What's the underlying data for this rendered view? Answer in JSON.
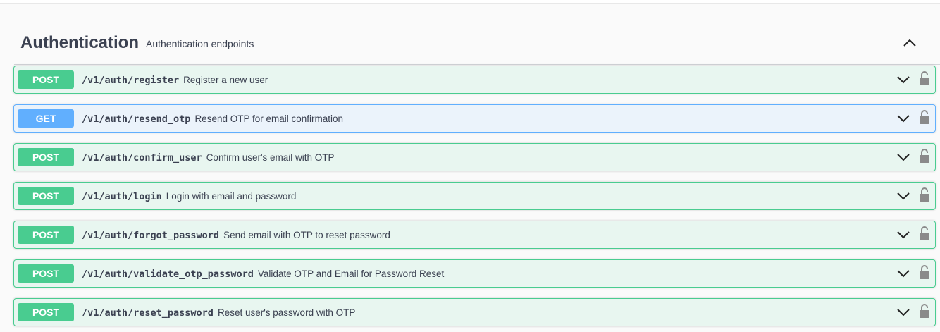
{
  "section": {
    "title": "Authentication",
    "description": "Authentication endpoints"
  },
  "operations": [
    {
      "method": "POST",
      "path": "/v1/auth/register",
      "summary": "Register a new user"
    },
    {
      "method": "GET",
      "path": "/v1/auth/resend_otp",
      "summary": "Resend OTP for email confirmation"
    },
    {
      "method": "POST",
      "path": "/v1/auth/confirm_user",
      "summary": "Confirm user's email with OTP"
    },
    {
      "method": "POST",
      "path": "/v1/auth/login",
      "summary": "Login with email and password"
    },
    {
      "method": "POST",
      "path": "/v1/auth/forgot_password",
      "summary": "Send email with OTP to reset password"
    },
    {
      "method": "POST",
      "path": "/v1/auth/validate_otp_password",
      "summary": "Validate OTP and Email for Password Reset"
    },
    {
      "method": "POST",
      "path": "/v1/auth/reset_password",
      "summary": "Reset user's password with OTP"
    }
  ],
  "icons": {
    "collapse": "chevron-up-icon",
    "expand": "chevron-down-icon",
    "lock": "lock-icon"
  },
  "colors": {
    "post": "#49cc90",
    "post_bg": "#e8f6f0",
    "get": "#61affe",
    "get_bg": "#ebf3fb",
    "text": "#3b4151"
  }
}
